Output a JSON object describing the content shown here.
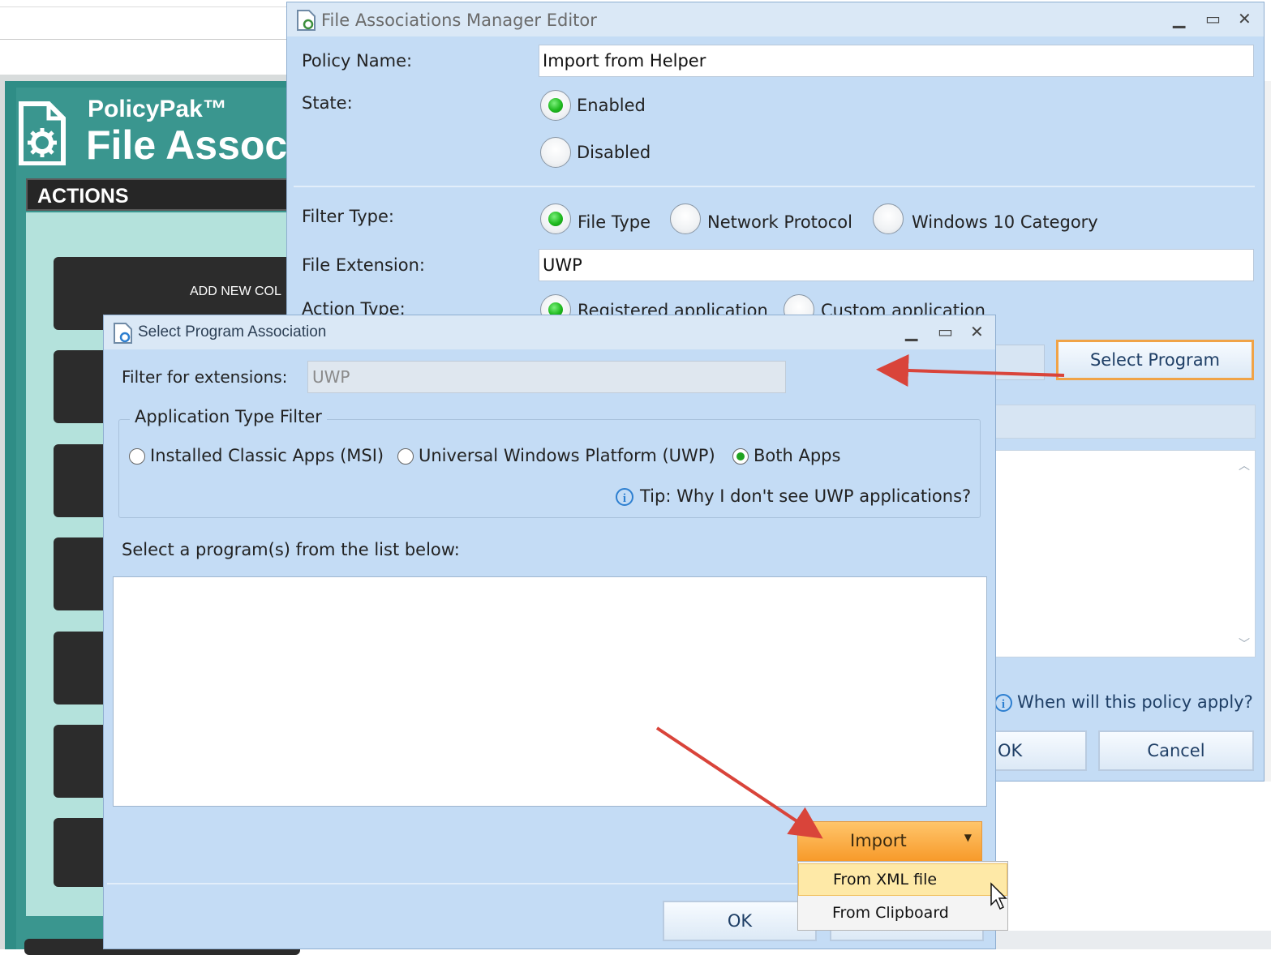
{
  "policypak": {
    "brand": "PolicyPak™",
    "title": "File Assoc",
    "actions_header": "ACTIONS",
    "add_new_button": "ADD NEW COL"
  },
  "editor": {
    "title": "File Associations Manager Editor",
    "policy_name_label": "Policy Name:",
    "policy_name_value": "Import from Helper",
    "state_label": "State:",
    "state_options": [
      "Enabled",
      "Disabled"
    ],
    "state_selected": "Enabled",
    "filter_type_label": "Filter Type:",
    "filter_type_options": [
      "File Type",
      "Network Protocol",
      "Windows 10 Category"
    ],
    "filter_type_selected": "File Type",
    "file_extension_label": "File Extension:",
    "file_extension_value": "UWP",
    "action_type_label": "Action Type:",
    "action_type_options": [
      "Registered application",
      "Custom application"
    ],
    "action_type_selected": "Registered application",
    "select_program_button": "Select Program",
    "when_apply_link": "When will this policy apply?",
    "ok_button": "OK",
    "cancel_button": "Cancel"
  },
  "dialog": {
    "title": "Select Program Association",
    "filter_label": "Filter for extensions:",
    "filter_value": "UWP",
    "app_type_group_label": "Application Type Filter",
    "app_type_options": [
      "Installed Classic Apps (MSI)",
      "Universal Windows Platform (UWP)",
      "Both Apps"
    ],
    "app_type_selected": "Both Apps",
    "tip_text": "Tip: Why I don't see UWP applications?",
    "list_prompt": "Select a program(s) from the list below:",
    "import_button": "Import",
    "import_menu": [
      "From XML file",
      "From Clipboard"
    ],
    "import_menu_highlighted": "From XML file",
    "ok_button": "OK"
  },
  "colors": {
    "teal_frame": "#2f8d86",
    "teal_panel": "#b4e2dc",
    "window_bg": "#c4dcf5",
    "accent_orange": "#f79a2a",
    "arrow_red": "#d9443a",
    "radio_green": "#1fba1f"
  }
}
